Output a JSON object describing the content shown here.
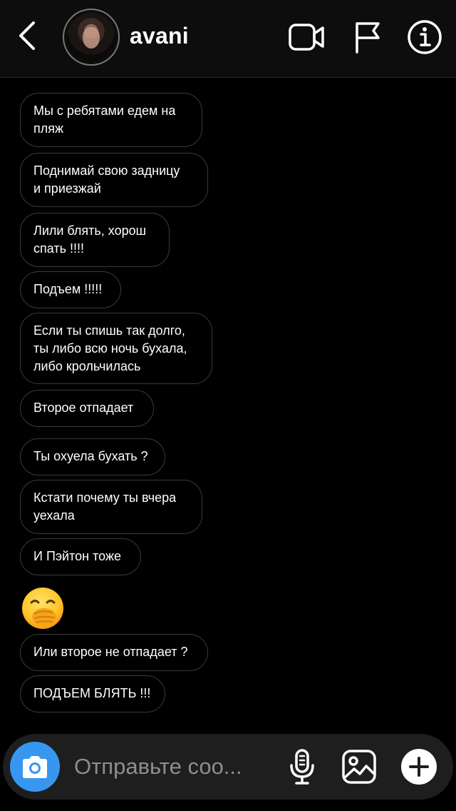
{
  "header": {
    "username": "avani",
    "icons": [
      "back-icon",
      "video-call-icon",
      "flag-icon",
      "info-icon"
    ]
  },
  "messages": [
    {
      "text": "Мы с ребятами едем на\nпляж"
    },
    {
      "text": "Поднимай свою задницу\nи приезжай"
    },
    {
      "text": "Лили блять, хорош\nспать !!!!"
    },
    {
      "text": "Подъем !!!!!"
    },
    {
      "text": "Если ты спишь так долго,\nты либо всю ночь бухала,\nлибо крольчилась"
    },
    {
      "text": "Второе отпадает"
    },
    {
      "text": "Ты охуела бухать ?"
    },
    {
      "text": "Кстати почему ты вчера\nуехала"
    },
    {
      "text": "И Пэйтон тоже"
    },
    {
      "emoji": "face-with-hand-over-mouth"
    },
    {
      "text": "Или второе не отпадает ?"
    },
    {
      "text": "ПОДЪЕМ БЛЯТЬ !!!"
    }
  ],
  "composer": {
    "placeholder": "Отправьте соо...",
    "icons": [
      "camera-icon",
      "microphone-icon",
      "gallery-icon",
      "plus-icon"
    ],
    "accent": "#3797f0"
  }
}
